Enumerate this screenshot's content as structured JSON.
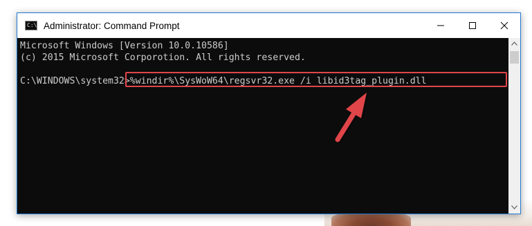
{
  "window": {
    "title": "Administrator: Command Prompt",
    "icon": "cmd-icon",
    "icon_glyph": "C:\\"
  },
  "controls": {
    "minimize_icon": "minimize-icon",
    "maximize_icon": "maximize-icon",
    "close_icon": "close-icon"
  },
  "console": {
    "line1": "Microsoft Windows [Version 10.0.10586]",
    "line2": "(c) 2015 Microsoft Corporotion. All rights reserved.",
    "prompt": "C:\\WINDOWS\\system32>",
    "command": "%windir%\\SysWoW64\\regsvr32.exe /i libid3tag_plugin.dll"
  },
  "annotation": {
    "highlight_color": "#e0454a",
    "arrow_color": "#e0454a",
    "arrow_icon": "pointer-arrow-icon"
  },
  "colors": {
    "console_bg": "#0c0c0c",
    "console_text": "#cccccc",
    "window_border": "#1f7ad1"
  }
}
